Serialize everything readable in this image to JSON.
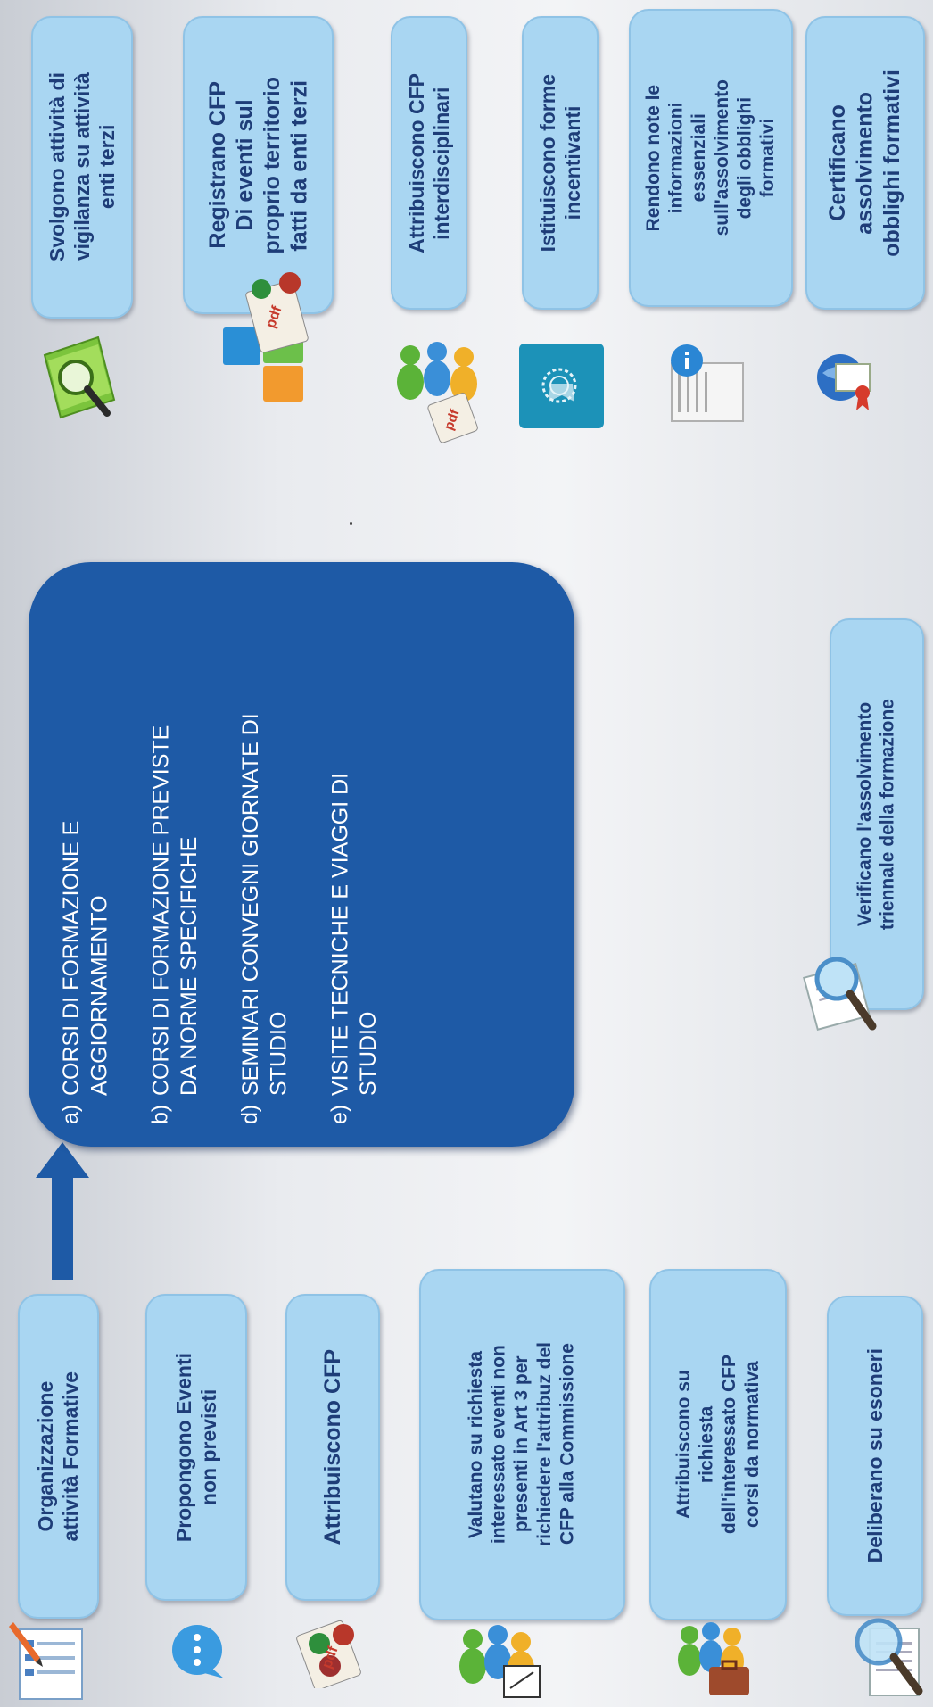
{
  "left_items": [
    {
      "text": "Organizzazione\nattività Formative",
      "icon": "form-checklist-icon"
    },
    {
      "text": "Propongono Eventi\nnon previsti",
      "icon": "chat-bubble-icon"
    },
    {
      "text": "Attribuiscono CFP",
      "icon": "pdf-document-icon"
    },
    {
      "text": "Valutano su richiesta\ninteressato eventi non\npresenti in Art 3 per\nrichiedere l'attribuz del\nCFP alla Commissione",
      "icon": "people-group-icon"
    },
    {
      "text": "Attribuiscono su\nrichiesta\ndell'interessato CFP\ncorsi da normativa",
      "icon": "people-briefcase-icon"
    },
    {
      "text": "Deliberano su esoneri",
      "icon": "magnifier-document-icon"
    }
  ],
  "main_box": {
    "items": [
      {
        "letter": "a)",
        "text": "CORSI DI FORMAZIONE E\nAGGIORNAMENTO"
      },
      {
        "letter": "b)",
        "text": "CORSI DI FORMAZIONE PREVISTE\nDA NORME SPECIFICHE"
      },
      {
        "letter": "d)",
        "text": "SEMINARI CONVEGNI GIORNATE DI\nSTUDIO"
      },
      {
        "letter": "e)",
        "text": "VISITE TECNICHE E VIAGGI DI\nSTUDIO"
      }
    ]
  },
  "verify_item": {
    "text": "Verificano l'assolvimento\ntriennale della formazione",
    "icon": "magnifier-document-icon"
  },
  "right_items": [
    {
      "text": "Svolgono attività di\nvigilanza su attività\nenti terzi",
      "icon": "magnifier-folder-icon"
    },
    {
      "text": "Registrano CFP\nDi eventi sul\nproprio territorio\nfatti da enti terzi",
      "icon": "pdf-blocks-icon"
    },
    {
      "text": "Attribuiscono CFP\ninterdisciplinari",
      "icon": "people-pdf-icon"
    },
    {
      "text": "Istituiscono forme\nincentivanti",
      "icon": "badge-icon"
    },
    {
      "text": "Rendono note le\ninformazioni\nessenziali\nsull'assolvimento\ndegli  obblighi\nformativi",
      "icon": "info-document-icon"
    },
    {
      "text": "Certificano\nassolvimento\nobblighi formativi",
      "icon": "certificate-globe-icon"
    }
  ],
  "colors": {
    "box_fill": "#a9d6f2",
    "box_text": "#1e3d78",
    "main_box_fill": "#1e5aa6",
    "arrow": "#1e5aa6"
  }
}
